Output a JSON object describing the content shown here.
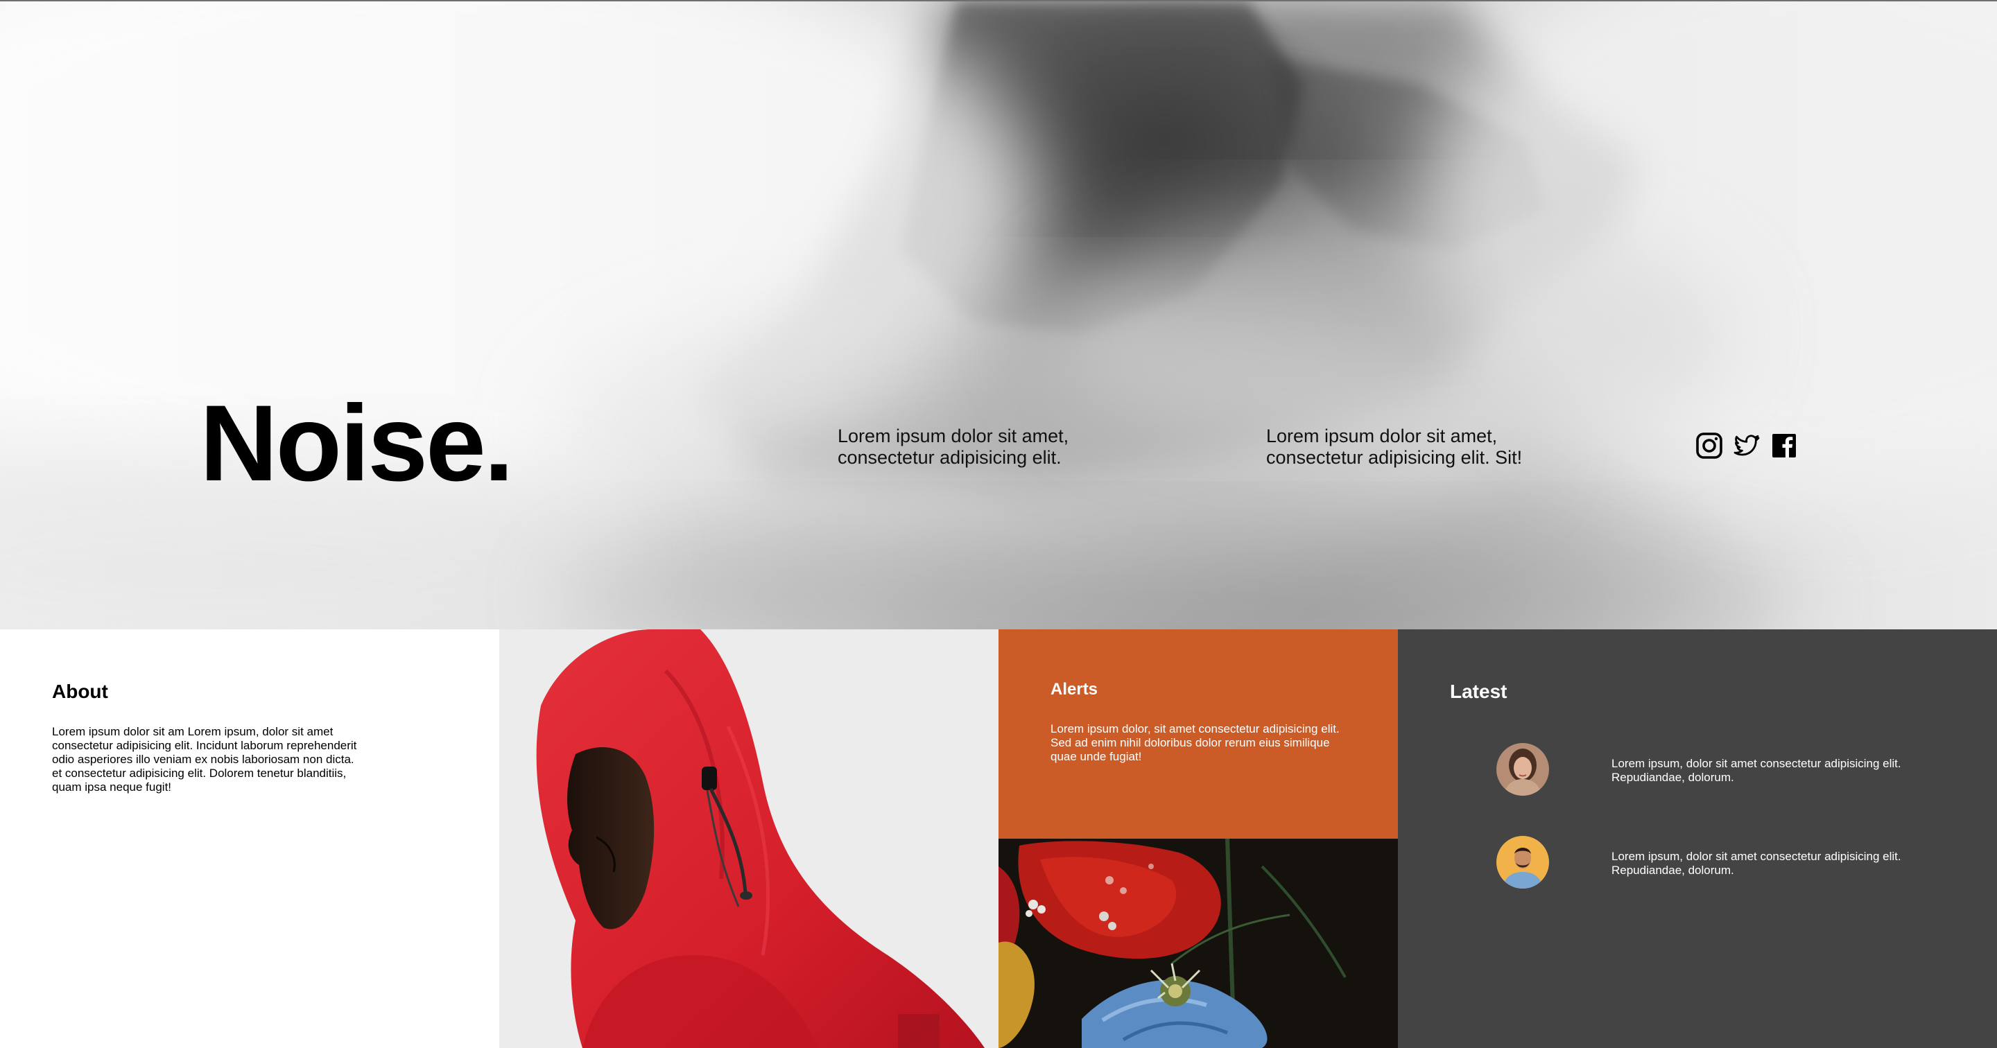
{
  "hero": {
    "title": "Noise.",
    "text_1": "Lorem ipsum dolor sit amet, consectetur adipisicing elit.",
    "text_2": "Lorem ipsum dolor sit amet, consectetur adipisicing elit. Sit!",
    "social": [
      {
        "icon": "instagram-icon"
      },
      {
        "icon": "twitter-icon"
      },
      {
        "icon": "facebook-icon"
      }
    ]
  },
  "about": {
    "heading": "About",
    "body": "Lorem ipsum dolor sit am Lorem ipsum, dolor sit amet consectetur adipisicing elit. Incidunt laborum reprehenderit odio asperiores illo veniam ex nobis laboriosam non dicta. et consectetur adipisicing elit. Dolorem tenetur blanditiis, quam ipsa neque fugit!"
  },
  "alerts": {
    "heading": "Alerts",
    "body": "Lorem ipsum dolor, sit amet consectetur adipisicing elit. Sed ad enim nihil doloribus dolor rerum eius similique quae unde fugiat!",
    "color": "#cb5c27"
  },
  "latest": {
    "heading": "Latest",
    "items": [
      {
        "text": "Lorem ipsum, dolor sit amet consectetur adipisicing elit. Repudiandae, dolorum."
      },
      {
        "text": "Lorem ipsum, dolor sit amet consectetur adipisicing elit. Repudiandae, dolorum."
      }
    ],
    "color": "#444444"
  }
}
